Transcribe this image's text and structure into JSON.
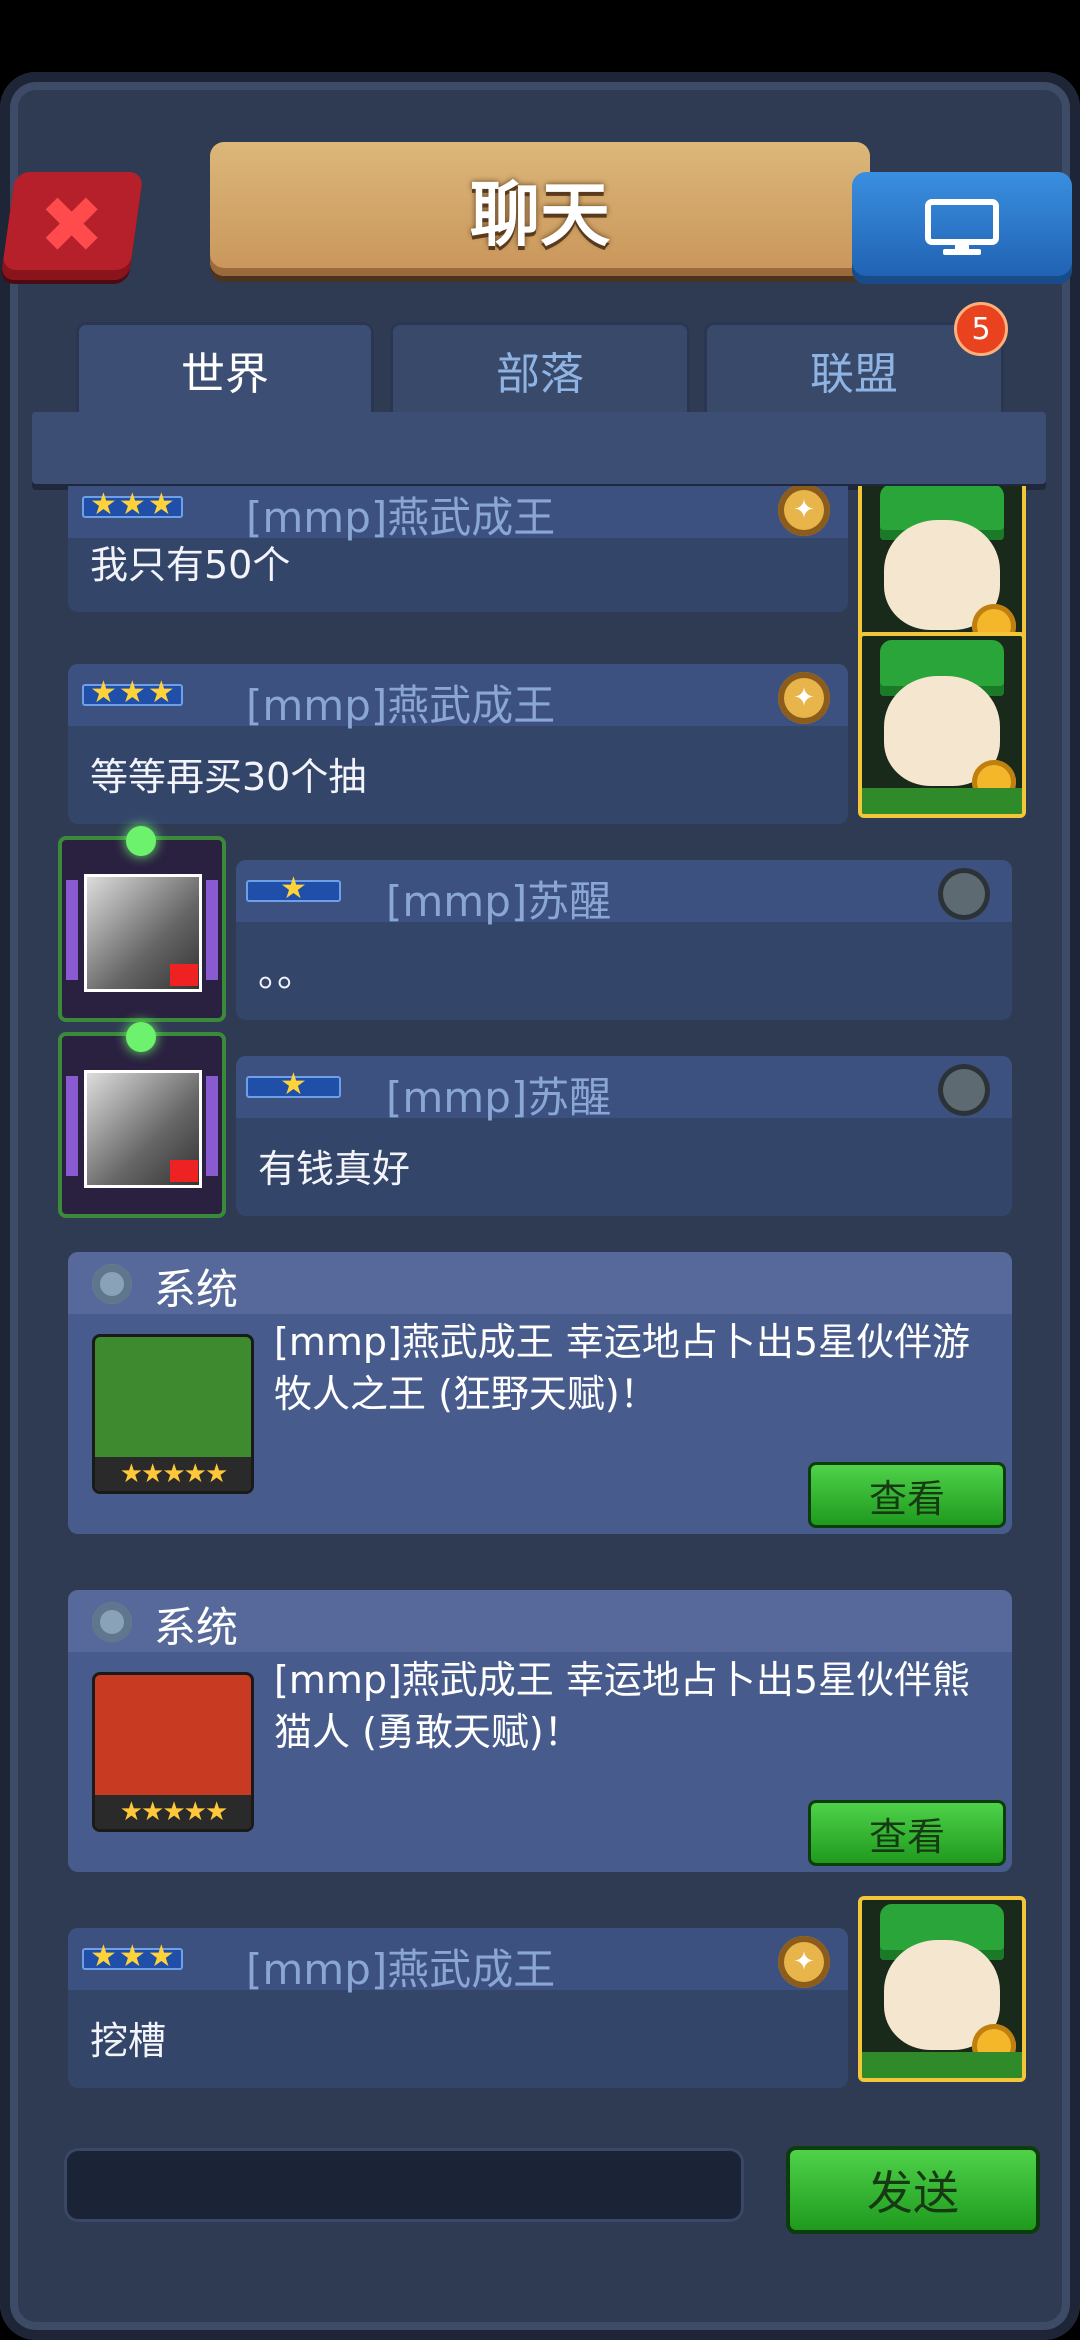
{
  "header": {
    "title": "聊天",
    "close_icon": "close-icon",
    "monitor_icon": "monitor-icon"
  },
  "tabs": [
    {
      "label": "世界",
      "active": true
    },
    {
      "label": "部落",
      "active": false
    },
    {
      "label": "联盟",
      "active": false
    }
  ],
  "alliance_badge": "5",
  "messages": [
    {
      "name": "[mmp]燕武成王",
      "text": "我只有50个",
      "stars": 3,
      "side": "right"
    },
    {
      "name": "[mmp]燕武成王",
      "text": "等等再买30个抽",
      "stars": 3,
      "side": "right"
    },
    {
      "name": "[mmp]苏醒",
      "text": "。。",
      "stars": 1,
      "side": "left"
    },
    {
      "name": "[mmp]苏醒",
      "text": "有钱真好",
      "stars": 1,
      "side": "left"
    },
    {
      "name": "[mmp]燕武成王",
      "text": "挖槽",
      "stars": 3,
      "side": "right"
    }
  ],
  "system": [
    {
      "title": "系统",
      "text": "[mmp]燕武成王 幸运地占卜出5星伙伴游牧人之王 (狂野天赋)！",
      "button": "查看",
      "stars": 5,
      "card_color": "#3e8a2e"
    },
    {
      "title": "系统",
      "text": "[mmp]燕武成王 幸运地占卜出5星伙伴熊猫人 (勇敢天赋)！",
      "button": "查看",
      "stars": 5,
      "card_color": "#c83a22"
    }
  ],
  "input": {
    "placeholder": ""
  },
  "send_label": "发送",
  "stars_glyph": "★★★★★"
}
